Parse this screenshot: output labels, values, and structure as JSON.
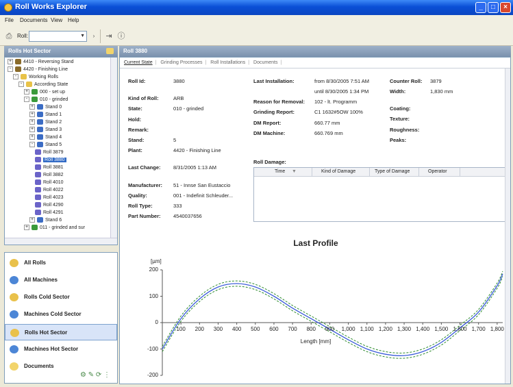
{
  "window": {
    "title": "Roll Works Explorer"
  },
  "menu": [
    "File",
    "Documents",
    "View",
    "Help"
  ],
  "toolbar": {
    "roll_label": "Roll:",
    "roll_value": ""
  },
  "left_header": "Rolls Hot Sector",
  "tree": [
    {
      "label": "4410 - Reversing Stand",
      "indent": 0,
      "exp": "+",
      "icon": "#8a6b2a"
    },
    {
      "label": "4420 - Finishing Line",
      "indent": 0,
      "exp": "-",
      "icon": "#8a6b2a"
    },
    {
      "label": "Working Rolls",
      "indent": 1,
      "exp": "-",
      "icon": "#e8c248"
    },
    {
      "label": "According State",
      "indent": 2,
      "exp": "-",
      "icon": "#e8c248"
    },
    {
      "label": "000 - set up",
      "indent": 3,
      "exp": "+",
      "icon": "#3a9a3a"
    },
    {
      "label": "010 - grinded",
      "indent": 3,
      "exp": "-",
      "icon": "#3a9a3a"
    },
    {
      "label": "Stand 0",
      "indent": 4,
      "exp": "+",
      "icon": "#3b6cc4"
    },
    {
      "label": "Stand 1",
      "indent": 4,
      "exp": "+",
      "icon": "#3b6cc4"
    },
    {
      "label": "Stand 2",
      "indent": 4,
      "exp": "+",
      "icon": "#3b6cc4"
    },
    {
      "label": "Stand 3",
      "indent": 4,
      "exp": "+",
      "icon": "#3b6cc4"
    },
    {
      "label": "Stand 4",
      "indent": 4,
      "exp": "+",
      "icon": "#3b6cc4"
    },
    {
      "label": "Stand 5",
      "indent": 4,
      "exp": "-",
      "icon": "#3b6cc4"
    },
    {
      "label": "Roll 3879",
      "indent": 5,
      "exp": "",
      "icon": "#6a63c8"
    },
    {
      "label": "Roll 3880",
      "indent": 5,
      "exp": "",
      "icon": "#6a63c8",
      "selected": true
    },
    {
      "label": "Roll 3881",
      "indent": 5,
      "exp": "",
      "icon": "#6a63c8"
    },
    {
      "label": "Roll 3882",
      "indent": 5,
      "exp": "",
      "icon": "#6a63c8"
    },
    {
      "label": "Roll 4010",
      "indent": 5,
      "exp": "",
      "icon": "#6a63c8"
    },
    {
      "label": "Roll 4022",
      "indent": 5,
      "exp": "",
      "icon": "#6a63c8"
    },
    {
      "label": "Roll 4023",
      "indent": 5,
      "exp": "",
      "icon": "#6a63c8"
    },
    {
      "label": "Roll 4290",
      "indent": 5,
      "exp": "",
      "icon": "#6a63c8"
    },
    {
      "label": "Roll 4291",
      "indent": 5,
      "exp": "",
      "icon": "#6a63c8"
    },
    {
      "label": "Stand 6",
      "indent": 4,
      "exp": "+",
      "icon": "#3b6cc4"
    },
    {
      "label": "011 - grinded and sur",
      "indent": 3,
      "exp": "+",
      "icon": "#3a9a3a"
    }
  ],
  "nav": [
    {
      "label": "All Rolls",
      "icon": "#e9c14b"
    },
    {
      "label": "All Machines",
      "icon": "#4c86d6"
    },
    {
      "label": "Rolls Cold Sector",
      "icon": "#e9c14b"
    },
    {
      "label": "Machines Cold Sector",
      "icon": "#4c86d6"
    },
    {
      "label": "Rolls Hot Sector",
      "icon": "#e9c14b",
      "selected": true
    },
    {
      "label": "Machines Hot Sector",
      "icon": "#4c86d6"
    },
    {
      "label": "Documents",
      "icon": "#f2d46b"
    }
  ],
  "main_header": "Roll 3880",
  "tabs": [
    "Current State",
    "Grinding Processes",
    "Roll Installations",
    "Documents"
  ],
  "fields": {
    "roll_id_label": "Roll Id:",
    "roll_id": "3880",
    "kind_label": "Kind of Roll:",
    "kind": "ARB",
    "state_label": "State:",
    "state": "010 - grinded",
    "hold_label": "Hold:",
    "remark_label": "Remark:",
    "stand_label": "Stand:",
    "stand": "5",
    "plant_label": "Plant:",
    "plant": "4420 - Finishing Line",
    "last_change_label": "Last Change:",
    "last_change": "8/31/2005 1:13 AM",
    "manufacturer_label": "Manufacturer:",
    "manufacturer": "51 - Innse San Eustaccio",
    "quality_label": "Quality:",
    "quality": "001 - Indefinit Schleuder...",
    "roll_type_label": "Roll Type:",
    "roll_type": "333",
    "part_number_label": "Part Number:",
    "part_number": "4540037656",
    "last_install_label": "Last Installation:",
    "last_install_from": "from 8/30/2005 7:51 AM",
    "last_install_until": "until 8/30/2005 1:34 PM",
    "reason_label": "Reason for Removal:",
    "reason": "102 - lt. Programm",
    "grinding_report_label": "Grinding Report:",
    "grinding_report": "C1 1632#5OW 100%",
    "dm_report_label": "DM Report:",
    "dm_report": "660.77 mm",
    "dm_machine_label": "DM Machine:",
    "dm_machine": "660.769 mm",
    "counter_roll_label": "Counter Roll:",
    "counter_roll": "3879",
    "width_label": "Width:",
    "width": "1,830 mm",
    "coating_label": "Coating:",
    "texture_label": "Texture:",
    "roughness_label": "Roughness:",
    "peaks_label": "Peaks:"
  },
  "damage": {
    "title": "Roll Damage:",
    "columns": [
      "Time",
      "Kind of Damage",
      "Type of Damage",
      "Operator"
    ]
  },
  "chart_data": {
    "type": "line",
    "title": "Last Profile",
    "ylabel": "[µm]",
    "xlabel": "Length [mm]",
    "ylim": [
      -200,
      200
    ],
    "xlim": [
      0,
      1830
    ],
    "yticks": [
      "200",
      "100",
      "0",
      "-100",
      "-200"
    ],
    "xticks": [
      "100",
      "200",
      "300",
      "400",
      "500",
      "600",
      "700",
      "800",
      "900",
      "1,000",
      "1,100",
      "1,200",
      "1,300",
      "1,400",
      "1,500",
      "1,600",
      "1,700",
      "1,800"
    ],
    "grid": false,
    "series": [
      {
        "style": "solid",
        "color": "#3a5bd9",
        "x": [
          0,
          100,
          200,
          300,
          400,
          500,
          600,
          700,
          800,
          900,
          1000,
          1100,
          1200,
          1300,
          1400,
          1500,
          1600,
          1700,
          1800,
          1830
        ],
        "y": [
          -100,
          15,
          90,
          135,
          148,
          135,
          100,
          55,
          15,
          -25,
          -65,
          -100,
          -120,
          -125,
          -110,
          -75,
          -20,
          40,
          140,
          185
        ]
      },
      {
        "style": "dashed",
        "color": "#2e8b2e",
        "x": [
          0,
          100,
          200,
          300,
          400,
          500,
          600,
          700,
          800,
          900,
          1000,
          1100,
          1200,
          1300,
          1400,
          1500,
          1600,
          1700,
          1800,
          1830
        ],
        "y": [
          -90,
          25,
          100,
          145,
          158,
          145,
          110,
          65,
          25,
          -15,
          -55,
          -90,
          -110,
          -115,
          -100,
          -65,
          -10,
          50,
          150,
          195
        ]
      },
      {
        "style": "dashed",
        "color": "#2e8b2e",
        "x": [
          0,
          100,
          200,
          300,
          400,
          500,
          600,
          700,
          800,
          900,
          1000,
          1100,
          1200,
          1300,
          1400,
          1500,
          1600,
          1700,
          1800,
          1830
        ],
        "y": [
          -110,
          5,
          80,
          125,
          138,
          125,
          90,
          45,
          5,
          -35,
          -75,
          -110,
          -130,
          -135,
          -120,
          -85,
          -30,
          30,
          130,
          175
        ]
      }
    ]
  }
}
